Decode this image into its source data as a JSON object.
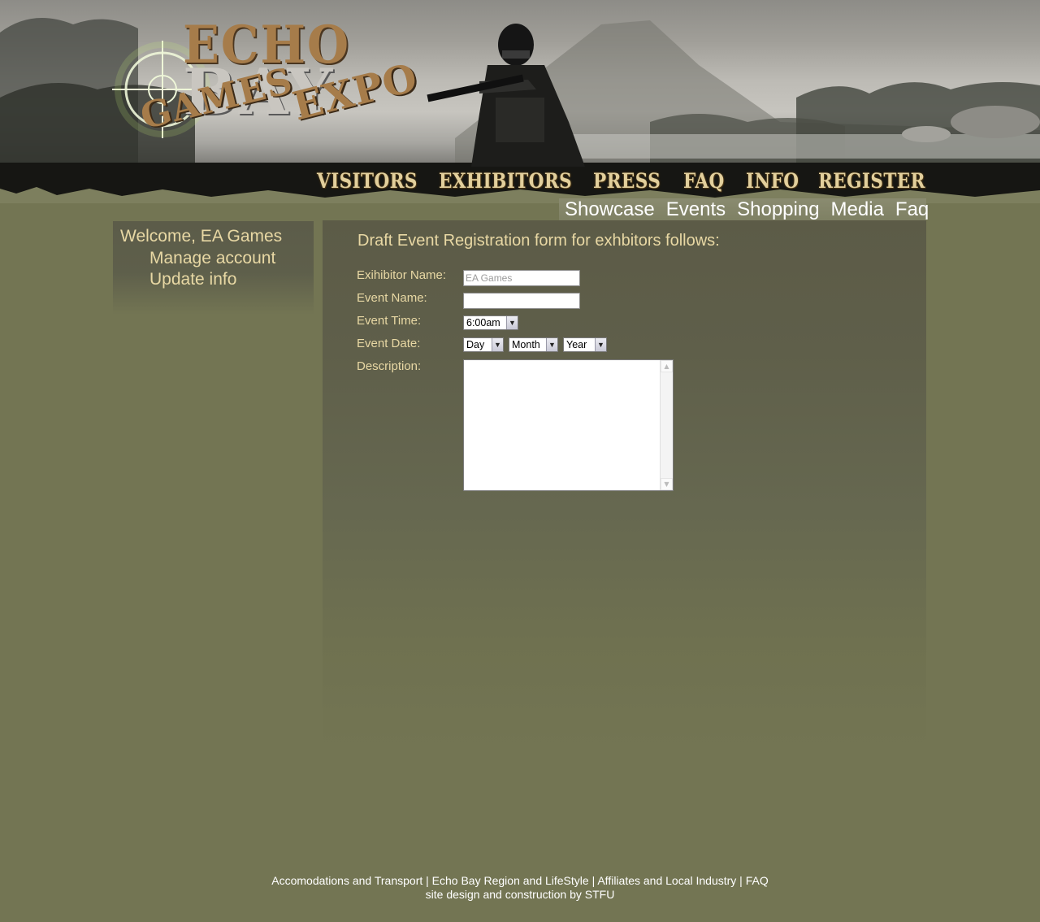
{
  "header": {
    "logo": {
      "line1": "ECHO",
      "line2": "BAY",
      "line3": "GAMES",
      "line4": "EXPO"
    }
  },
  "main_nav": [
    {
      "label": "VISITORS"
    },
    {
      "label": "EXHIBITORS"
    },
    {
      "label": "PRESS"
    },
    {
      "label": "FAQ"
    },
    {
      "label": "INFO"
    },
    {
      "label": "REGISTER"
    }
  ],
  "sub_nav": [
    {
      "label": "Showcase"
    },
    {
      "label": "Events"
    },
    {
      "label": "Shopping"
    },
    {
      "label": "Media"
    },
    {
      "label": "Faq"
    }
  ],
  "sidebar": {
    "welcome": "Welcome, EA Games",
    "links": [
      {
        "label": "Manage account"
      },
      {
        "label": "Update info"
      }
    ]
  },
  "form": {
    "title": "Draft Event Registration form for exhbitors follows:",
    "exhibitor_label": "Exihibitor Name:",
    "exhibitor_value": "EA Games",
    "event_name_label": "Event Name:",
    "event_name_value": "",
    "event_time_label": "Event Time:",
    "event_time_value": "6:00am",
    "event_date_label": "Event Date:",
    "day_value": "Day",
    "month_value": "Month",
    "year_value": "Year",
    "description_label": "Description:",
    "description_value": ""
  },
  "footer": {
    "links": [
      "Accomodations and Transport",
      "Echo Bay Region and LifeStyle",
      "Affiliates and Local Industry",
      "FAQ"
    ],
    "separator": " | ",
    "credit": "site design and construction by STFU"
  },
  "colors": {
    "page_bg": "#737553",
    "label_text": "#e8d8a4",
    "nav_text": "#e2cf9c",
    "logo_brown": "#a67c4a"
  }
}
